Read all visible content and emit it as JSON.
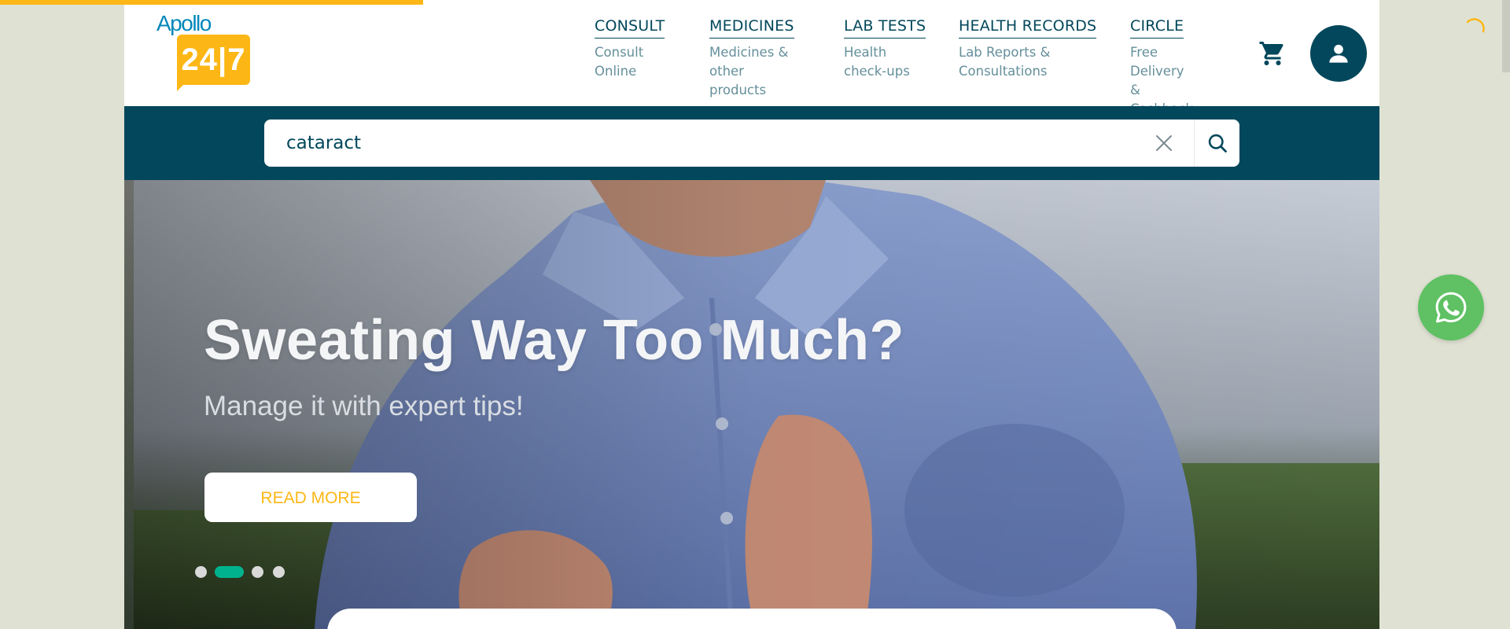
{
  "logo": {
    "wordmark": "Apollo",
    "badge": "24|7"
  },
  "nav": {
    "items": [
      {
        "title": "CONSULT",
        "subtitle": "Consult\nOnline"
      },
      {
        "title": "MEDICINES",
        "subtitle": "Medicines &\nother products"
      },
      {
        "title": "LAB TESTS",
        "subtitle": "Health\ncheck-ups"
      },
      {
        "title": "HEALTH RECORDS",
        "subtitle": "Lab Reports &\nConsultations"
      },
      {
        "title": "CIRCLE",
        "subtitle": "Free Delivery\n& Cashback"
      }
    ]
  },
  "search": {
    "value": "cataract"
  },
  "hero": {
    "title": "Sweating Way Too Much?",
    "subtitle": "Manage it with expert tips!",
    "cta_label": "READ MORE",
    "slide_count": 4,
    "active_slide": 2
  },
  "page_load_progress": 0.28,
  "icons": {
    "cart": "cart-icon",
    "profile": "user-icon",
    "clear": "close-icon",
    "search": "search-icon",
    "whatsapp": "whatsapp-icon",
    "loading": "spinner-icon"
  },
  "colors": {
    "brand_teal": "#02475b",
    "brand_orange": "#fcb716",
    "nav_sub": "#658f9b",
    "carousel_active": "#00b38e",
    "whatsapp_green": "#5fc163",
    "page_background": "#dfe1d3"
  }
}
